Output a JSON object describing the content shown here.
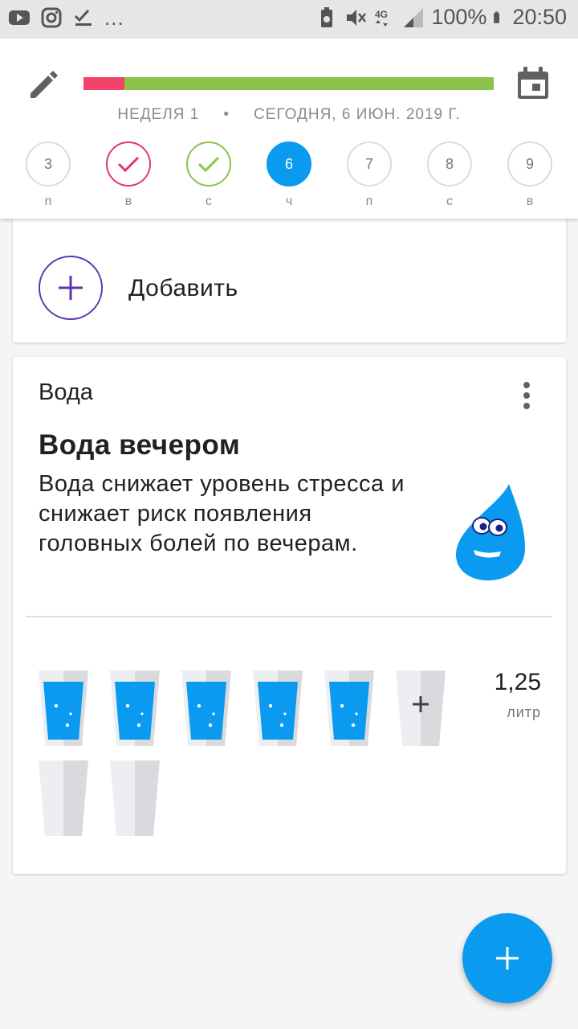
{
  "status_bar": {
    "icons_left": [
      "youtube-icon",
      "instagram-icon",
      "checklist-icon"
    ],
    "more": "...",
    "icons_right": [
      "battery-saver-icon",
      "mute-icon",
      "4g-icon",
      "signal-icon"
    ],
    "battery": "100%",
    "time": "20:50"
  },
  "header": {
    "progress": {
      "red_fraction": 0.1,
      "green_fraction": 0.9,
      "colors": {
        "red": "#f2436a",
        "green": "#8bc34a"
      }
    },
    "week_label": "НЕДЕЛЯ 1",
    "separator": "•",
    "date_label": "СЕГОДНЯ, 6 ИЮН. 2019 Г.",
    "days": [
      {
        "num": "3",
        "label": "п",
        "state": "empty"
      },
      {
        "num": "",
        "label": "в",
        "state": "red"
      },
      {
        "num": "",
        "label": "с",
        "state": "green"
      },
      {
        "num": "6",
        "label": "ч",
        "state": "today"
      },
      {
        "num": "7",
        "label": "п",
        "state": "empty"
      },
      {
        "num": "8",
        "label": "с",
        "state": "empty"
      },
      {
        "num": "9",
        "label": "в",
        "state": "empty"
      }
    ]
  },
  "add_card": {
    "label": "Добавить"
  },
  "water_card": {
    "title": "Вода",
    "tip_title": "Вода вечером",
    "tip_text": "Вода снижает уровень стресса и снижает риск появления головных болей по вечерам.",
    "glasses_filled": 5,
    "glasses_total": 8,
    "amount": "1,25",
    "unit": "литр"
  },
  "accent_color": "#0a9af0"
}
